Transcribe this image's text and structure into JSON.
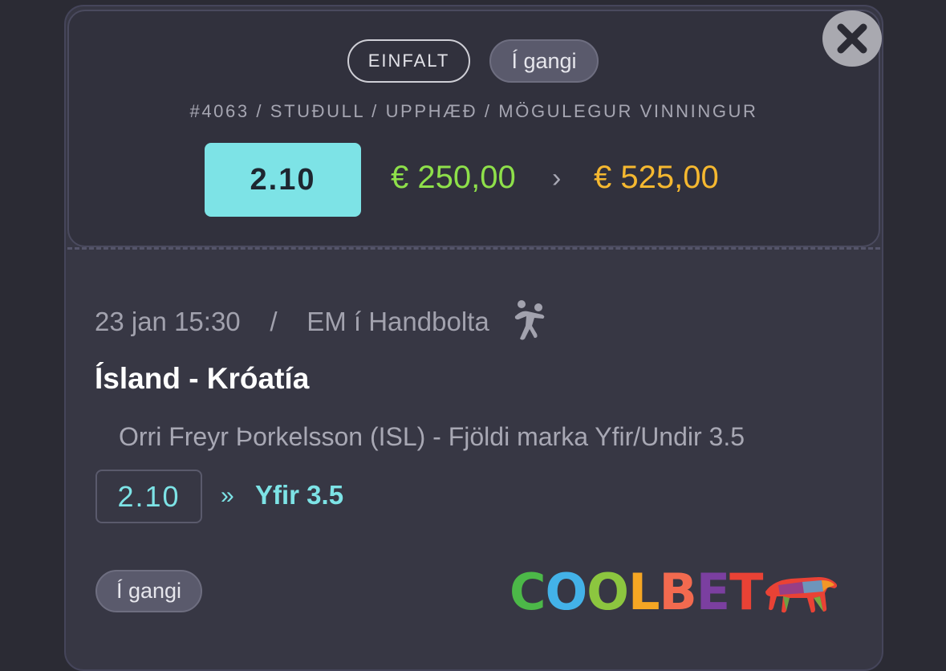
{
  "bet": {
    "type_label": "EINFALT",
    "status": "Í gangi",
    "meta_line": "#4063 / STUÐULL / UPPHÆÐ / MÖGULEGUR VINNINGUR",
    "odds": "2.10",
    "stake": "€ 250,00",
    "separator": "›",
    "payout": "€ 525,00"
  },
  "event": {
    "date_time": "23 jan 15:30",
    "separator": "/",
    "competition": "EM í Handbolta",
    "sport_icon": "handball-player-icon",
    "match": "Ísland - Króatía",
    "market": "Orri Freyr Þorkelsson (ISL) - Fjöldi marka Yfir/Undir 3.5",
    "selection_odds": "2.10",
    "selection_arrow": "»",
    "selection": "Yfir 3.5",
    "status": "Í gangi"
  },
  "brand": {
    "logo_letters": [
      "C",
      "O",
      "O",
      "L",
      "B",
      "E",
      "T"
    ],
    "logo_colors": [
      "#4cb848",
      "#43b2e8",
      "#8cc63f",
      "#f5a623",
      "#f26a4f",
      "#7b3fa0",
      "#e94235"
    ],
    "logo_icon": "bear-mascot-icon"
  },
  "controls": {
    "close_icon": "close-icon"
  },
  "colors": {
    "accent_cyan": "#7de3e6",
    "stake_green": "#8ee04a",
    "payout_orange": "#f5b830",
    "background": "#2b2b34",
    "card": "#373744"
  }
}
